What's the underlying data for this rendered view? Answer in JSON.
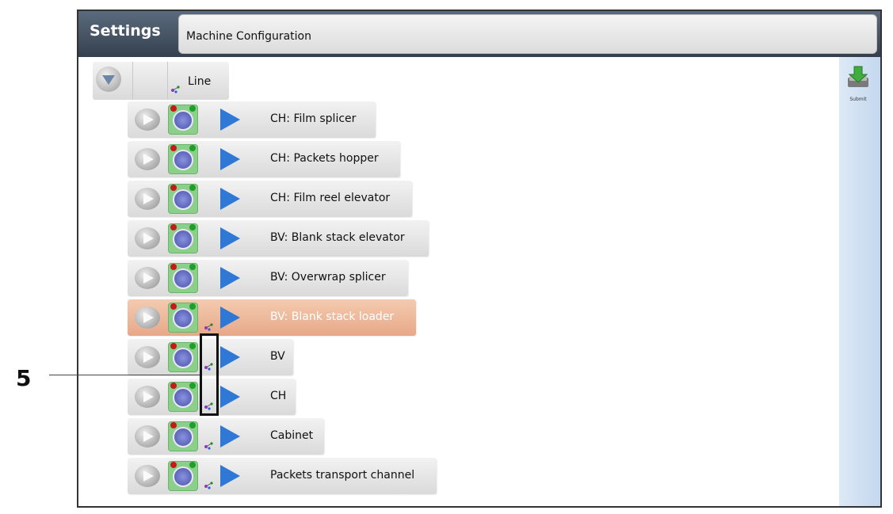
{
  "window": {
    "title": "Settings",
    "subtitle": "Machine Configuration",
    "submit_label": "Submit"
  },
  "tree_root": {
    "label": "Line"
  },
  "rows": [
    {
      "label": "CH: Film splicer",
      "selected": false
    },
    {
      "label": "CH: Packets hopper",
      "selected": false
    },
    {
      "label": "CH: Film reel elevator",
      "selected": false
    },
    {
      "label": "BV: Blank stack elevator",
      "selected": false
    },
    {
      "label": "BV: Overwrap splicer",
      "selected": false
    },
    {
      "label": "BV: Blank stack loader",
      "selected": true
    },
    {
      "label": "BV",
      "selected": false
    },
    {
      "label": "CH",
      "selected": false
    },
    {
      "label": "Cabinet",
      "selected": false
    },
    {
      "label": "Packets transport channel",
      "selected": false
    }
  ],
  "callout": {
    "number": "5"
  },
  "colors": {
    "selected_row": "#e7a888",
    "header": "#34404e",
    "accent_blue": "#2f78d6"
  }
}
